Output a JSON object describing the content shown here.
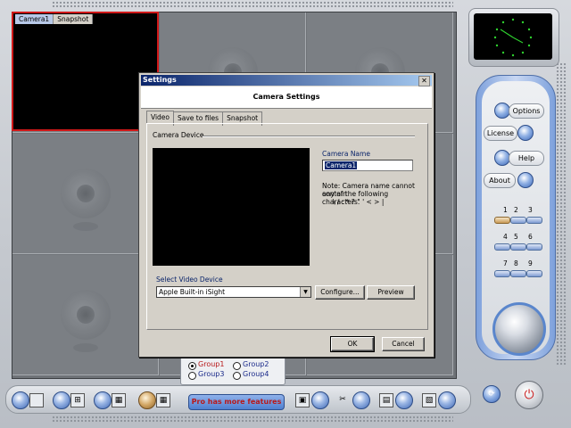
{
  "camera_tabs": [
    "Camera1",
    "Snapshot"
  ],
  "right_panel": {
    "options": "Options",
    "license": "License",
    "help": "Help",
    "about": "About",
    "group_numbers": [
      "1",
      "2",
      "3",
      "4",
      "5",
      "6",
      "7",
      "8",
      "9"
    ]
  },
  "groups": [
    "Group1",
    "Group2",
    "Group3",
    "Group4"
  ],
  "pro_badge": "Pro has more features",
  "dialog": {
    "title": "Settings",
    "close": "✕",
    "header": "Camera Settings",
    "tabs": [
      "Video",
      "Save to files",
      "Snapshot"
    ],
    "camera_device_label": "Camera Device",
    "camera_name_label": "Camera Name",
    "camera_name_value": "Camera1",
    "note_line1": "Note: Camera name cannot contain",
    "note_line2": "any of the following characters.",
    "note_line3": "\\ / : * ? \" ' < > |",
    "select_device_label": "Select Video Device",
    "device_value": "Apple Built-in iSight",
    "configure": "Configure...",
    "preview": "Preview",
    "ok": "OK",
    "cancel": "Cancel"
  }
}
